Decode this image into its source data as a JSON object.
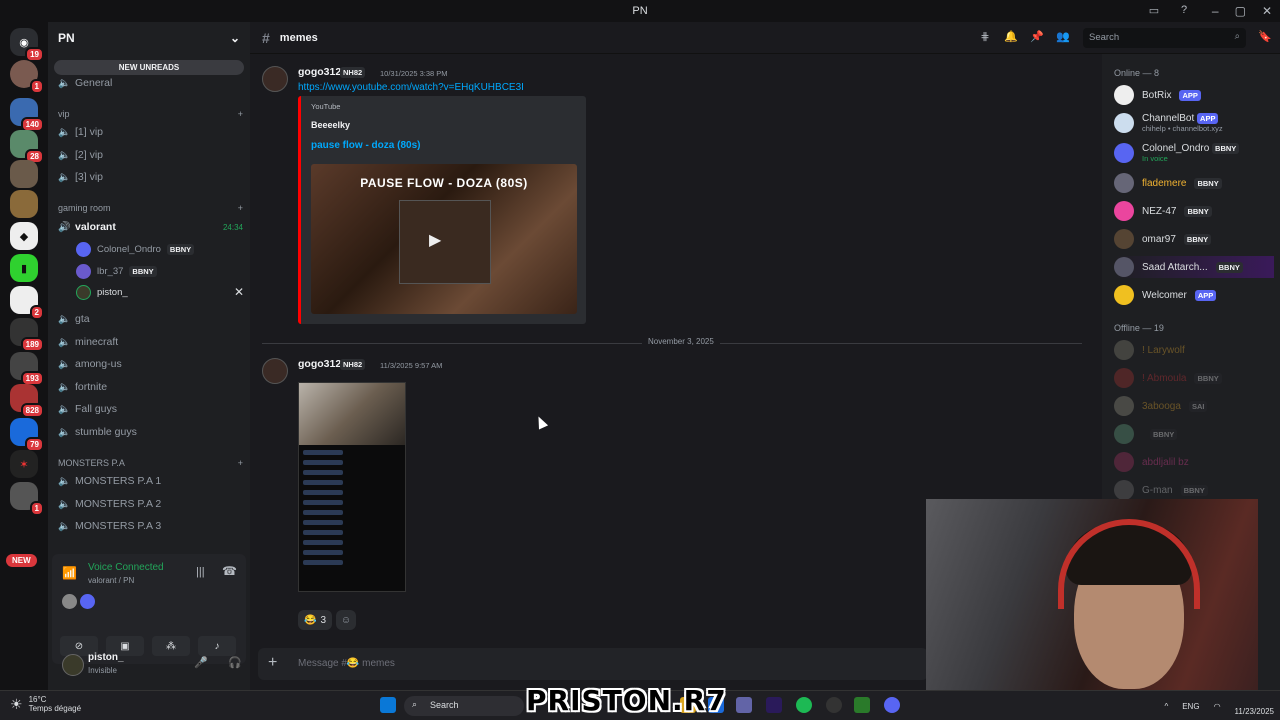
{
  "window": {
    "title": "PN"
  },
  "servers": {
    "badges": [
      "19",
      "1",
      "140",
      "28",
      "2",
      "189",
      "193",
      "828",
      "79",
      "1"
    ],
    "new_label": "NEW"
  },
  "sidebar": {
    "guild_name": "PN",
    "new_unreads": "NEW UNREADS",
    "general": "General",
    "vip_category": "vip",
    "vip_channels": [
      "[1] vip",
      "[2] vip",
      "[3] vip"
    ],
    "gaming_category": "gaming room",
    "valorant": "valorant",
    "valorant_timer": "24:34",
    "voice_users": [
      {
        "name": "Colonel_Ondro",
        "tag": "BBNY"
      },
      {
        "name": "lbr_37",
        "tag": "BBNY"
      },
      {
        "name": "piston_",
        "tag": ""
      }
    ],
    "channels": [
      "gta",
      "minecraft",
      "among-us",
      "fortnite",
      "Fall guys",
      "stumble guys"
    ],
    "monsters_category": "MONSTERS P.A",
    "monsters_channels": [
      "MONSTERS P.A 1",
      "MONSTERS P.A 2",
      "MONSTERS P.A 3"
    ]
  },
  "voice": {
    "status": "Voice Connected",
    "location": "valorant / PN"
  },
  "user": {
    "name": "piston_",
    "status": "Invisible"
  },
  "channel": {
    "name": "memes",
    "search_placeholder": "Search",
    "composer_placeholder": "Message #😂 memes"
  },
  "messages": [
    {
      "author": "gogo312",
      "tag": "NH82",
      "time": "10/31/2025 3:38 PM",
      "link": "https://www.youtube.com/watch?v=EHqKUHBCE3I",
      "embed": {
        "provider": "YouTube",
        "author": "Beeeelky",
        "title": "pause flow - doza (80s)",
        "thumb_text": "PAUSE FLOW - DOZA (80S)"
      }
    },
    {
      "author": "gogo312",
      "tag": "NH82",
      "time": "11/3/2025 9:57 AM",
      "reaction_emoji": "😂",
      "reaction_count": "3"
    }
  ],
  "date_divider": "November 3, 2025",
  "members": {
    "online_label": "Online — 8",
    "offline_label": "Offline — 19",
    "online": [
      {
        "name": "BotRix",
        "tag": "APP",
        "sub": ""
      },
      {
        "name": "ChannelBot",
        "tag": "APP",
        "sub": "chihelp • channelbot.xyz"
      },
      {
        "name": "Colonel_Ondro",
        "tag": "BBNY",
        "sub": "In voice"
      },
      {
        "name": "flademere",
        "tag": "BBNY",
        "sub": ""
      },
      {
        "name": "NEZ-47",
        "tag": "BBNY",
        "sub": ""
      },
      {
        "name": "omar97",
        "tag": "BBNY",
        "sub": ""
      },
      {
        "name": "Saad Attarch...",
        "tag": "BBNY",
        "sub": ""
      },
      {
        "name": "Welcomer",
        "tag": "APP",
        "sub": ""
      }
    ],
    "offline": [
      {
        "name": "! Larywolf",
        "tag": ""
      },
      {
        "name": "! Abmoula",
        "tag": "BBNY"
      },
      {
        "name": "3abooga",
        "tag": "SAI"
      },
      {
        "name": "",
        "tag": "BBNY"
      },
      {
        "name": "abdljalil bz",
        "tag": ""
      },
      {
        "name": "G-man",
        "tag": "BBNY"
      }
    ]
  },
  "taskbar": {
    "temp": "16°C",
    "weather": "Temps dégagé",
    "search": "Search",
    "lang": "ENG",
    "date": "11/23/2025"
  },
  "watermark": "PRISTON.R7",
  "colors": {
    "accent": "#5865f2",
    "voice_green": "#23a55a",
    "link": "#00a8fc",
    "youtube_red": "#ff0000",
    "badge_red": "#da373c"
  }
}
